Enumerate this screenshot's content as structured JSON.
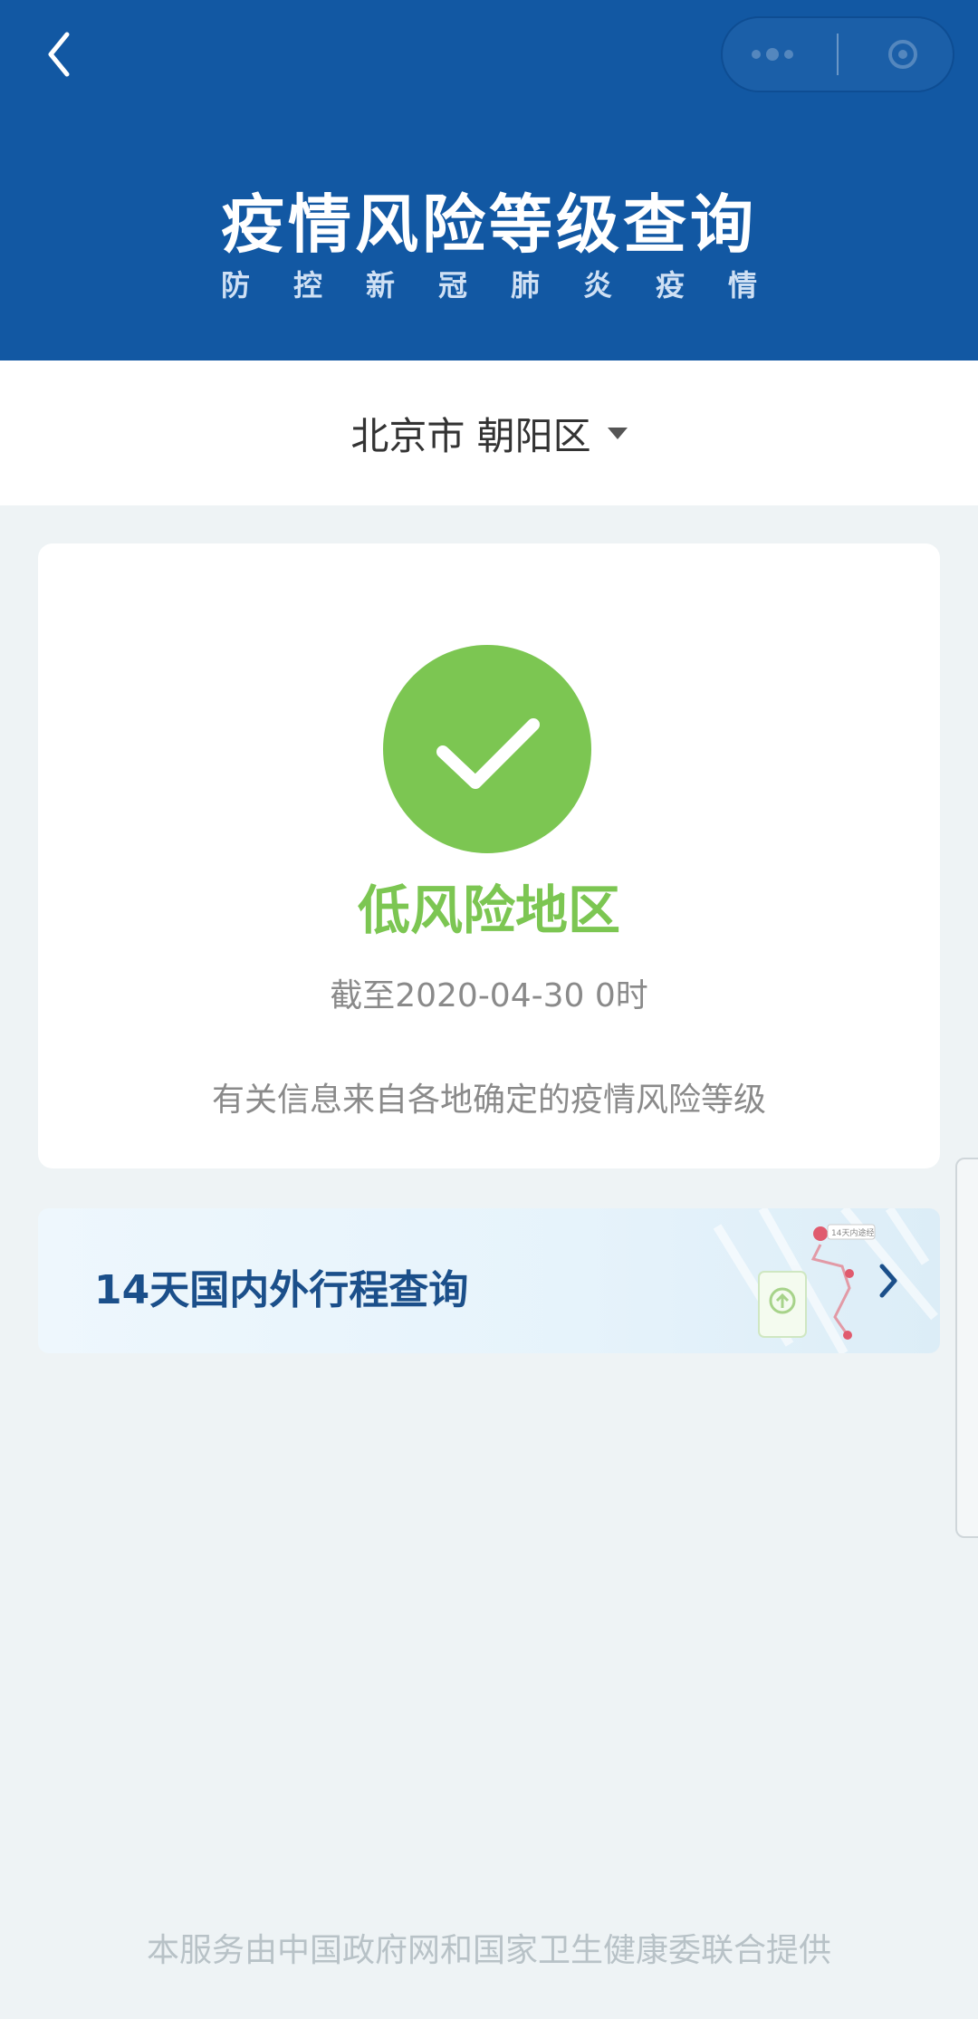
{
  "header": {
    "title": "疫情风险等级查询",
    "subtitle": "防控新冠肺炎疫情",
    "back_icon": "chevron-left-icon",
    "capsule_icons": [
      "more-icon",
      "close-icon"
    ]
  },
  "region": {
    "label": "北京市 朝阳区",
    "dropdown_icon": "caret-down-icon"
  },
  "risk_card": {
    "status_icon": "check-circle-icon",
    "level": "低风险地区",
    "as_of": "截至2020-04-30 0时",
    "note": "有关信息来自各地确定的疫情风险等级"
  },
  "travel": {
    "label": "14天国内外行程查询",
    "arrow_icon": "chevron-right-icon",
    "illustration_tag": "14天内途经"
  },
  "footer": {
    "text": "本服务由中国政府网和国家卫生健康委联合提供"
  },
  "colors": {
    "header_bg": "#1258a3",
    "success_green": "#7cc652",
    "page_bg": "#eef3f5",
    "link_blue": "#1b4f8a"
  }
}
